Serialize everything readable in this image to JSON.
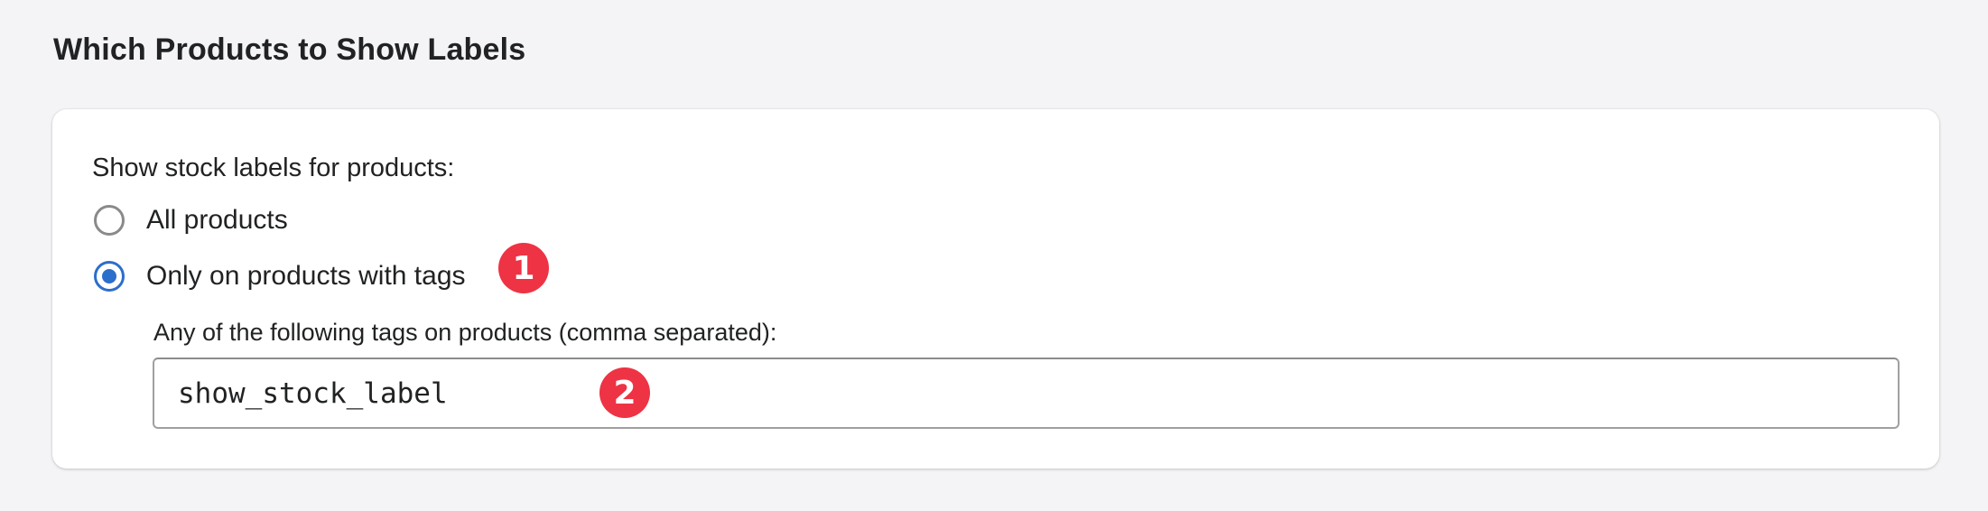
{
  "section": {
    "title": "Which Products to Show Labels"
  },
  "settings": {
    "group_label": "Show stock labels for products:",
    "options": [
      {
        "label": "All products",
        "selected": false
      },
      {
        "label": "Only on products with tags",
        "selected": true
      }
    ],
    "tags_field": {
      "label": "Any of the following tags on products (comma separated):",
      "value": "show_stock_label"
    }
  },
  "badges": [
    "1",
    "2"
  ],
  "colors": {
    "accent": "#2c6ecb",
    "badge": "#ee3344",
    "background": "#f4f4f6"
  }
}
